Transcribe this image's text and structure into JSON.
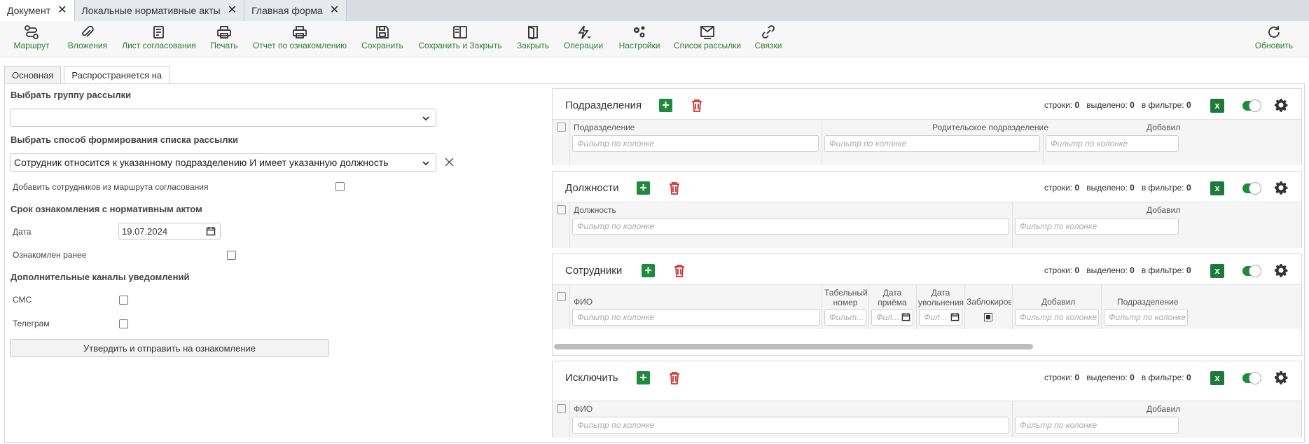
{
  "doc_tabs": [
    {
      "label": "Документ"
    },
    {
      "label": "Локальные нормативные акты"
    },
    {
      "label": "Главная форма"
    }
  ],
  "toolbar": {
    "route": "Маршрут",
    "attachments": "Вложения",
    "approval_sheet": "Лист согласования",
    "print": "Печать",
    "read_report": "Отчет по ознакомлению",
    "save": "Сохранить",
    "save_close": "Сохранить и Закрыть",
    "close": "Закрыть",
    "operations": "Операции",
    "settings": "Настройки",
    "mailing_list": "Список рассылки",
    "links": "Связки",
    "refresh": "Обновить"
  },
  "inner_tabs": {
    "main": "Основная",
    "applies_to": "Распространяется на"
  },
  "form": {
    "mailing_group_label": "Выбрать группу рассылки",
    "mailing_group_value": "",
    "method_label": "Выбрать способ формирования списка рассылки",
    "method_value": "Сотрудник относится к указанному подразделению И имеет указанную должность",
    "add_from_route_label": "Добавить сотрудников из маршрута согласования",
    "term_label": "Срок ознакомления с нормативным актом",
    "date_label": "Дата",
    "date_value": "19.07.2024",
    "read_earlier_label": "Ознакомлен ранее",
    "channels_label": "Дополнительные каналы уведомлений",
    "sms_label": "СМС",
    "telegram_label": "Телеграм",
    "submit_label": "Утвердить и отправить на ознакомление"
  },
  "stats_labels": {
    "rows": "строки:",
    "selected": "выделено:",
    "in_filter": "в фильтре:"
  },
  "filter_placeholder": "Фильтр по колонке",
  "filter_placeholder_short": "Фильт...",
  "filter_placeholder_date": "Фил...",
  "panels": {
    "departments": {
      "title": "Подразделения",
      "rows": "0",
      "selected": "0",
      "in_filter": "0",
      "columns": [
        "Подразделение",
        "Родительское подразделение",
        "Добавил"
      ]
    },
    "positions": {
      "title": "Должности",
      "rows": "0",
      "selected": "0",
      "in_filter": "0",
      "columns": [
        "Должность",
        "Добавил"
      ]
    },
    "employees": {
      "title": "Сотрудники",
      "rows": "0",
      "selected": "0",
      "in_filter": "0",
      "columns": [
        "ФИО",
        "Табельный номер",
        "Дата приёма",
        "Дата увольнения",
        "Заблокиров",
        "Добавил",
        "Подразделение"
      ]
    },
    "exclude": {
      "title": "Исключить",
      "rows": "0",
      "selected": "0",
      "in_filter": "0",
      "columns": [
        "ФИО",
        "Добавил"
      ]
    }
  }
}
